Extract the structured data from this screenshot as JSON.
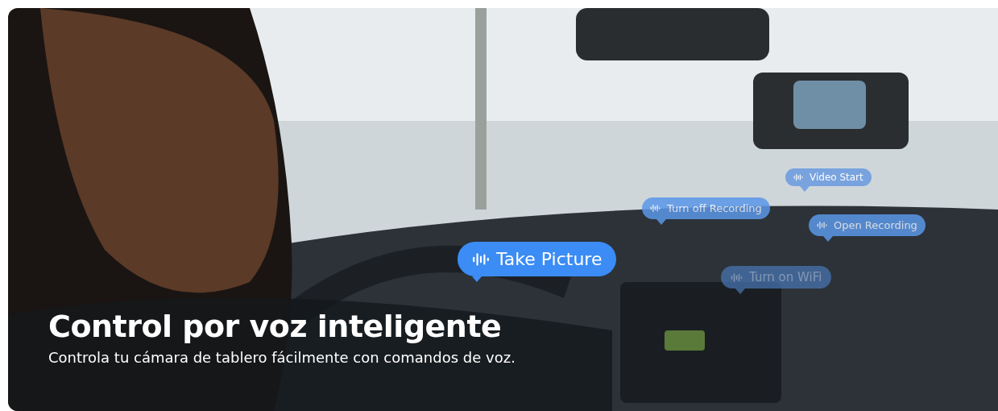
{
  "banner": {
    "kind": "picture",
    "voice_commands": [
      {
        "text": "Take Picture",
        "kind": "primary"
      },
      {
        "text": "Video Start",
        "kind": "faint"
      },
      {
        "text": "Turn off Recording",
        "kind": "secondary"
      },
      {
        "text": "Open Recording",
        "kind": "secondary"
      },
      {
        "text": "Turn on WiFi",
        "kind": "dim"
      }
    ],
    "title": "Control por voz inteligente",
    "subtitle": "Controla tu cámara de tablero fácilmente con comandos de voz."
  }
}
